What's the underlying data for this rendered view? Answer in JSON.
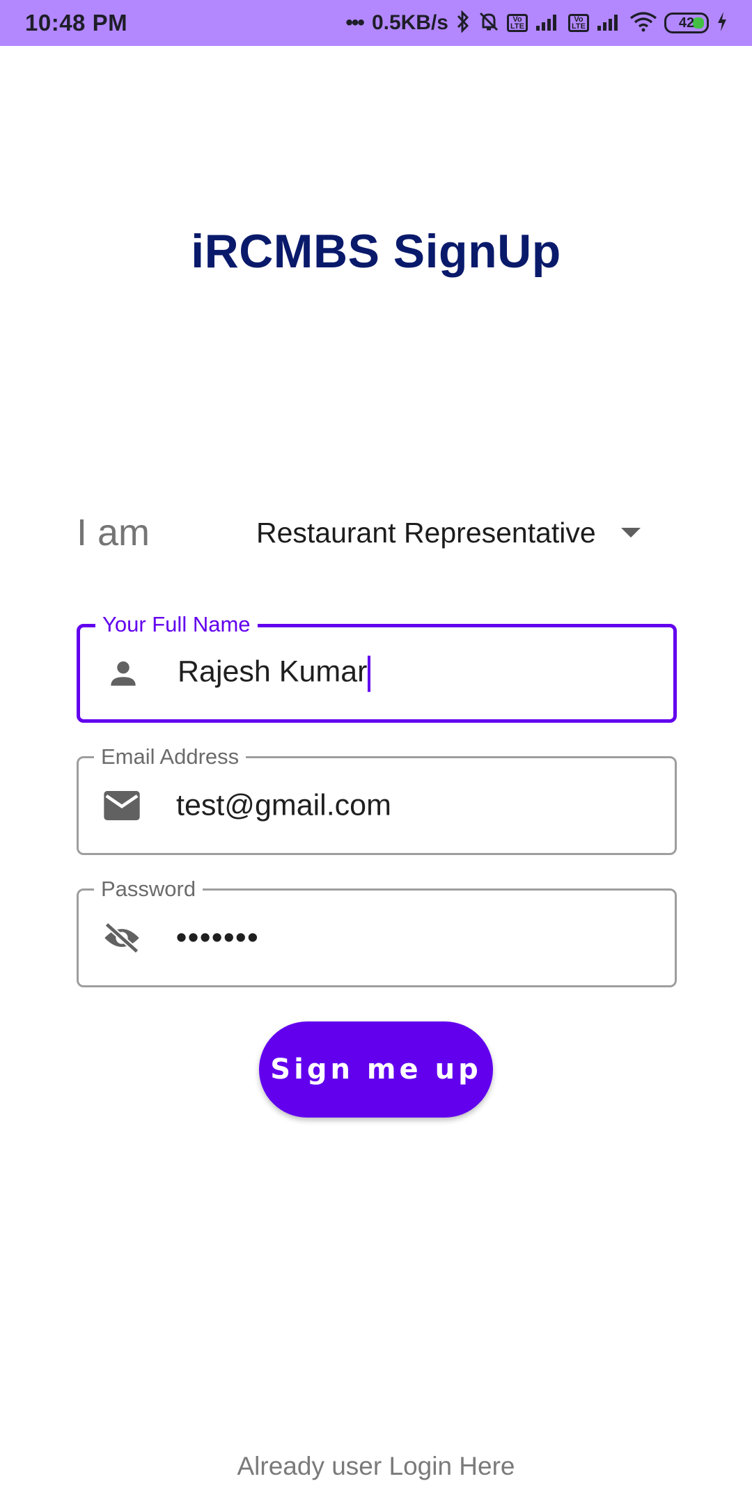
{
  "status_bar": {
    "time": "10:48 PM",
    "dots": "•••",
    "speed": "0.5KB/s",
    "volte_label": "Vo LTE",
    "battery": "42",
    "icons": [
      "bluetooth-icon",
      "bell-muted-icon",
      "volte-icon",
      "signal-icon",
      "wifi-icon",
      "battery-icon",
      "charging-icon"
    ]
  },
  "header": {
    "title": "iRCMBS SignUp"
  },
  "role": {
    "label": "I am",
    "selected": "Restaurant Representative"
  },
  "fields": {
    "full_name": {
      "label": "Your Full Name",
      "value": "Rajesh Kumar",
      "icon": "person-icon"
    },
    "email": {
      "label": "Email Address",
      "value": "test@gmail.com",
      "icon": "email-icon"
    },
    "password": {
      "label": "Password",
      "value": "•••••••",
      "icon": "visibility-off-icon"
    }
  },
  "actions": {
    "signup_label": "Sign me up",
    "login_link": "Already user Login Here"
  },
  "colors": {
    "status_bar": "#b388ff",
    "accent": "#6200ee",
    "title": "#0a1a6b"
  }
}
